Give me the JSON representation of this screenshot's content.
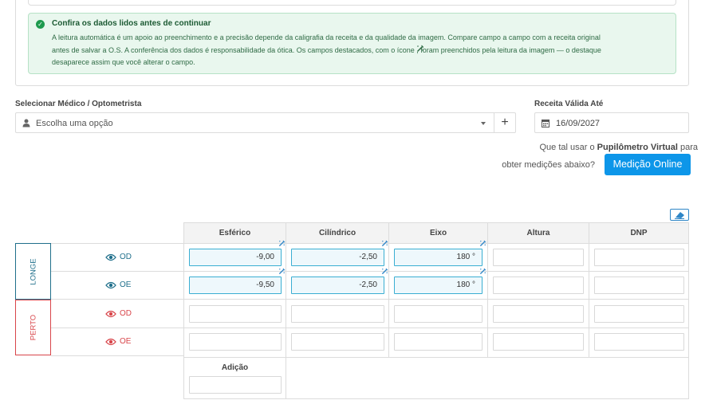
{
  "alert": {
    "title": "Confira os dados lidos antes de continuar",
    "line1": "A leitura automática é um apoio ao preenchimento e a precisão depende da caligrafia da receita e da qualidade da imagem. Compare campo a campo com a receita original",
    "line2a": "antes de salvar a O.S. A conferência dos dados é responsabilidade da ótica. Os campos destacados, com o ícone",
    "line2b": ", foram preenchidos pela leitura da imagem — o destaque",
    "line3": "desaparece assim que você alterar o campo."
  },
  "medico": {
    "label": "Selecionar Médico / Optometrista",
    "placeholder": "Escolha uma opção",
    "add_label": "+"
  },
  "validade": {
    "label": "Receita Válida Até",
    "value": "16/09/2027"
  },
  "pupilometro": {
    "text_before": "Que tal usar o",
    "brand": "Pupilômetro Virtual",
    "text_after": "para",
    "line2": "obter medições abaixo?",
    "button": "Medição Online"
  },
  "grid": {
    "columns": [
      "Esférico",
      "Cilíndrico",
      "Eixo",
      "Altura",
      "DNP"
    ],
    "groups": [
      {
        "name": "LONGE",
        "color": "#1f6f8b"
      },
      {
        "name": "PERTO",
        "color": "#d8454a"
      }
    ],
    "rows": [
      {
        "eye": "OD",
        "color": "#1f6f8b",
        "esferico": "-9,00",
        "cilindrico": "-2,50",
        "eixo": "180 °",
        "altura": "",
        "dnp": ""
      },
      {
        "eye": "OE",
        "color": "#1f6f8b",
        "esferico": "-9,50",
        "cilindrico": "-2,50",
        "eixo": "180 °",
        "altura": "",
        "dnp": ""
      },
      {
        "eye": "OD",
        "color": "#d8454a",
        "esferico": "",
        "cilindrico": "",
        "eixo": "",
        "altura": "",
        "dnp": ""
      },
      {
        "eye": "OE",
        "color": "#d8454a",
        "esferico": "",
        "cilindrico": "",
        "eixo": "",
        "altura": "",
        "dnp": ""
      }
    ],
    "adicao_label": "Adição",
    "adicao_value": ""
  },
  "colors": {
    "accent": "#0d96e9",
    "longe": "#1f6f8b",
    "perto": "#d8454a",
    "highlight_border": "#3aaed2"
  },
  "icons": [
    "check-circle-icon",
    "magic-wand-icon",
    "person-icon",
    "caret-down-icon",
    "plus-icon",
    "calendar-icon",
    "eye-icon",
    "eraser-icon"
  ]
}
